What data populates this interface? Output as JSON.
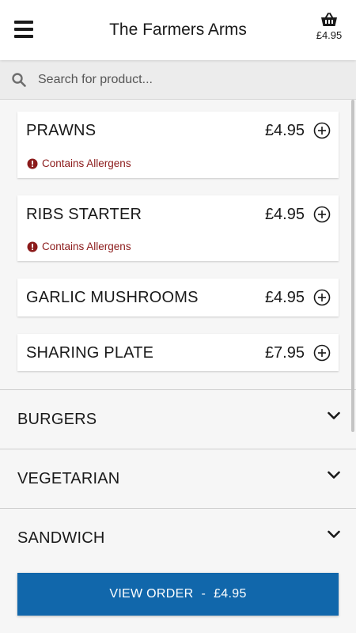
{
  "header": {
    "title": "The Farmers Arms",
    "basket_total": "£4.95"
  },
  "search": {
    "placeholder": "Search for product..."
  },
  "products": [
    {
      "name": "PRAWNS",
      "price": "£4.95",
      "allergen": "Contains Allergens"
    },
    {
      "name": "RIBS STARTER",
      "price": "£4.95",
      "allergen": "Contains Allergens"
    },
    {
      "name": "GARLIC MUSHROOMS",
      "price": "£4.95"
    },
    {
      "name": "SHARING PLATE",
      "price": "£7.95"
    }
  ],
  "categories": [
    "BURGERS",
    "VEGETARIAN",
    "SANDWICH"
  ],
  "order_button": {
    "label": "VIEW ORDER",
    "separator": "-",
    "total": "£4.95"
  },
  "colors": {
    "primary_button": "#1167ab",
    "allergen_text": "#8b1a1a"
  }
}
